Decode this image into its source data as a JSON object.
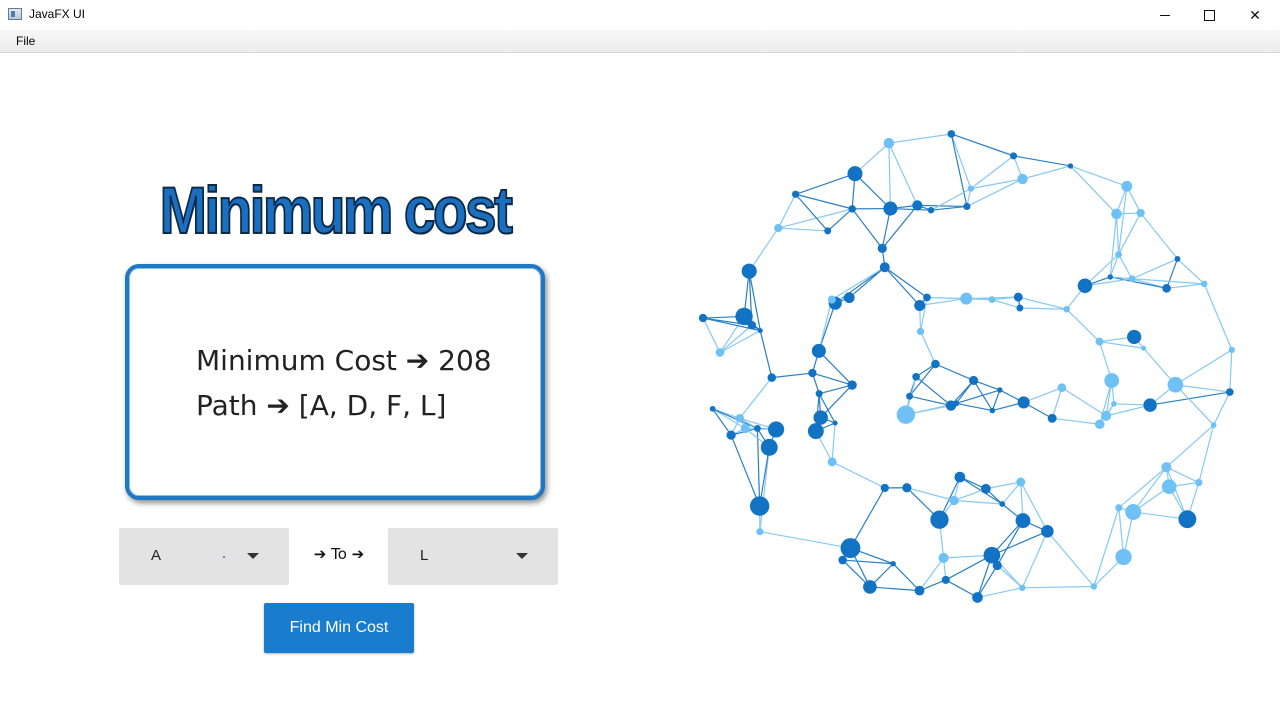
{
  "window": {
    "title": "JavaFX UI",
    "minimize_icon": "minimize-icon",
    "maximize_icon": "maximize-icon",
    "close_icon": "close-icon"
  },
  "menu": {
    "items": [
      {
        "label": "File"
      }
    ]
  },
  "main": {
    "heading": "Minimum cost",
    "result": {
      "cost_line": "Minimum Cost ➔ 208",
      "path_line": "Path ➔ [A, D, F, L]"
    },
    "from_select": {
      "value": "A"
    },
    "to_label": "➔ To ➔",
    "to_select": {
      "value": "L"
    },
    "find_button": "Find Min Cost"
  },
  "graphic": {
    "name": "network-graph-illustration",
    "colors": {
      "dark_node": "#1273c4",
      "light_node": "#6ec0f5",
      "dark_edge": "#2a7fc3",
      "light_edge": "#86c9f2"
    }
  },
  "colors": {
    "accent": "#1a7ccc",
    "heading": "#1a6fc0",
    "border": "#1f78c4",
    "combo_bg": "#e3e3e3"
  }
}
